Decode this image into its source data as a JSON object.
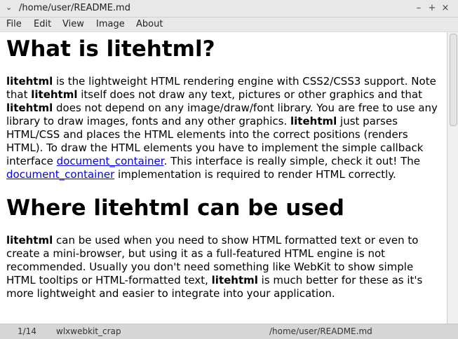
{
  "window": {
    "title": "/home/user/README.md",
    "wm_menu": "⌄",
    "minimize": "–",
    "maximize": "+",
    "close": "×"
  },
  "menu": [
    "File",
    "Edit",
    "View",
    "Image",
    "About"
  ],
  "doc": {
    "h1": "What is litehtml?",
    "p1": {
      "s1": "litehtml",
      "t1": " is the lightweight HTML rendering engine with CSS2/CSS3 support. Note that ",
      "s2": "litehtml",
      "t2": " itself does not draw any text, pictures or other graphics and that ",
      "s3": "litehtml",
      "t3": " does not depend on any image/draw/font library. You are free to use any library to draw images, fonts and any other graphics. ",
      "s4": "litehtml",
      "t4": " just parses HTML/CSS and places the HTML elements into the correct positions (renders HTML). To draw the HTML elements you have to implement the simple callback interface ",
      "link1": "document_container",
      "t5": ". This interface is really simple, check it out! The ",
      "link2": "document_container",
      "t6": " implementation is required to render HTML correctly."
    },
    "h2": "Where litehtml can be used",
    "p2": {
      "s1": "litehtml",
      "t1": " can be used when you need to show HTML formatted text or even to create a mini-browser, but using it as a full-featured HTML engine is not recommended. Usually you don't need something like WebKit to show simple HTML tooltips or HTML-formatted text, ",
      "s2": "litehtml",
      "t2": " is much better for these as it's more lightweight and easier to integrate into your application."
    }
  },
  "status": {
    "page": "1/14",
    "name": "wlxwebkit_crap",
    "path": "/home/user/README.md"
  }
}
